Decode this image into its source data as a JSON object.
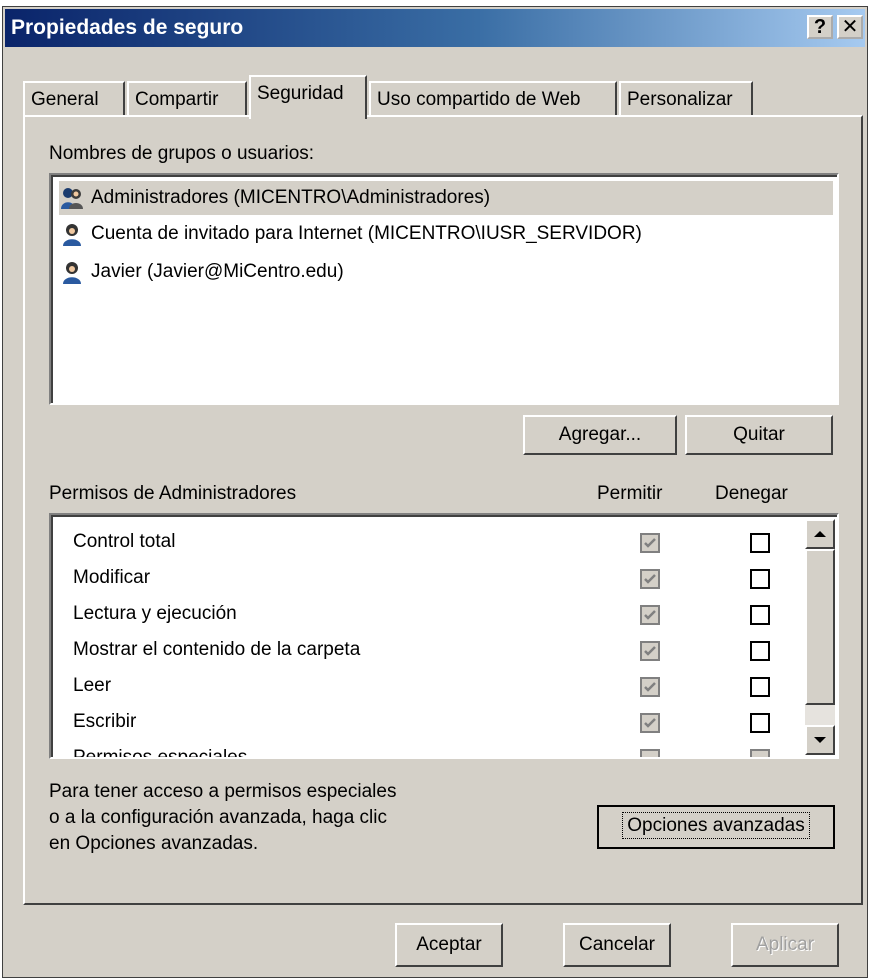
{
  "window": {
    "title": "Propiedades de seguro",
    "help_button": "?",
    "close_button": "✕"
  },
  "tabs": [
    {
      "label": "General",
      "active": false
    },
    {
      "label": "Compartir",
      "active": false
    },
    {
      "label": "Seguridad",
      "active": true
    },
    {
      "label": "Uso compartido de Web",
      "active": false
    },
    {
      "label": "Personalizar",
      "active": false
    }
  ],
  "users_section": {
    "label": "Nombres de grupos o usuarios:",
    "items": [
      {
        "label": "Administradores (MICENTRO\\Administradores)",
        "icon": "users-group-icon",
        "selected": true
      },
      {
        "label": "Cuenta de invitado para Internet (MICENTRO\\IUSR_SERVIDOR)",
        "icon": "user-icon",
        "selected": false
      },
      {
        "label": "Javier (Javier@MiCentro.edu)",
        "icon": "user-icon",
        "selected": false
      }
    ],
    "add_button": "Agregar...",
    "remove_button": "Quitar"
  },
  "permissions": {
    "label": "Permisos de Administradores",
    "allow_header": "Permitir",
    "deny_header": "Denegar",
    "rows": [
      {
        "name": "Control total",
        "allow": true,
        "deny": false
      },
      {
        "name": "Modificar",
        "allow": true,
        "deny": false
      },
      {
        "name": "Lectura y ejecución",
        "allow": true,
        "deny": false
      },
      {
        "name": "Mostrar el contenido de la carpeta",
        "allow": true,
        "deny": false
      },
      {
        "name": "Leer",
        "allow": true,
        "deny": false
      },
      {
        "name": "Escribir",
        "allow": true,
        "deny": false
      },
      {
        "name": "Permisos especiales",
        "allow": false,
        "deny": false
      }
    ]
  },
  "advanced": {
    "text_line1": "Para tener acceso a permisos especiales",
    "text_line2": "o a la configuración avanzada, haga clic",
    "text_line3": "en Opciones avanzadas.",
    "button": "Opciones avanzadas"
  },
  "footer": {
    "ok": "Aceptar",
    "cancel": "Cancelar",
    "apply": "Aplicar"
  },
  "colors": {
    "title_start": "#0a246a",
    "title_end": "#a6caf0",
    "face": "#d4d0c8"
  }
}
